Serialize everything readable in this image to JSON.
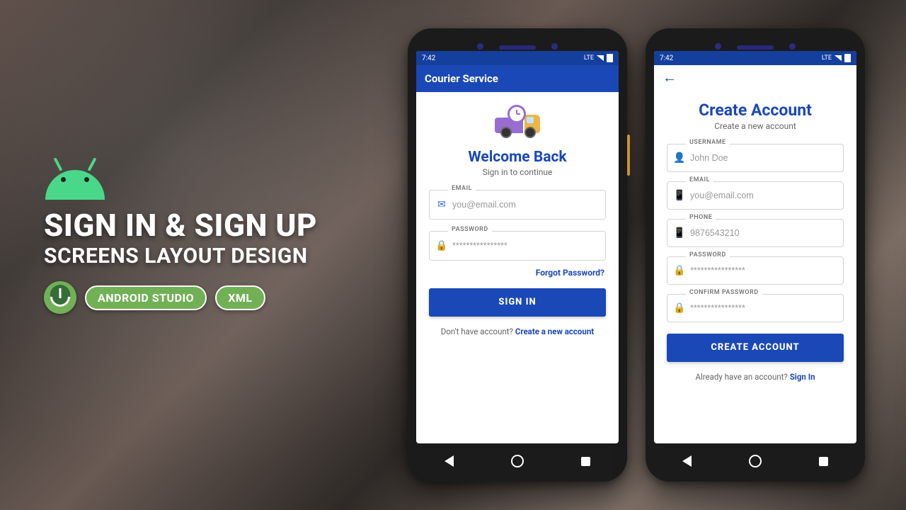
{
  "promo": {
    "title_line1": "SIGN IN & SIGN UP",
    "title_line2": "SCREENS LAYOUT DESIGN",
    "badge1": "ANDROID STUDIO",
    "badge2": "XML"
  },
  "status": {
    "time": "7:42",
    "net": "LTE"
  },
  "signin": {
    "appbar_title": "Courier Service",
    "heading": "Welcome Back",
    "subtitle": "Sign in to continue",
    "email_label": "EMAIL",
    "email_placeholder": "you@email.com",
    "password_label": "PASSWORD",
    "password_placeholder": "****************",
    "forgot": "Forgot Password?",
    "button": "SIGN IN",
    "footer_text": "Don't have account? ",
    "footer_link": "Create a new account"
  },
  "signup": {
    "heading": "Create Account",
    "subtitle": "Create a new account",
    "username_label": "USERNAME",
    "username_placeholder": "John Doe",
    "email_label": "EMAIL",
    "email_placeholder": "you@email.com",
    "phone_label": "PHONE",
    "phone_placeholder": "9876543210",
    "password_label": "PASSWORD",
    "password_placeholder": "****************",
    "confirm_label": "CONFIRM PASSWORD",
    "confirm_placeholder": "****************",
    "button": "CREATE ACCOUNT",
    "footer_text": "Already have an account? ",
    "footer_link": "Sign In"
  }
}
